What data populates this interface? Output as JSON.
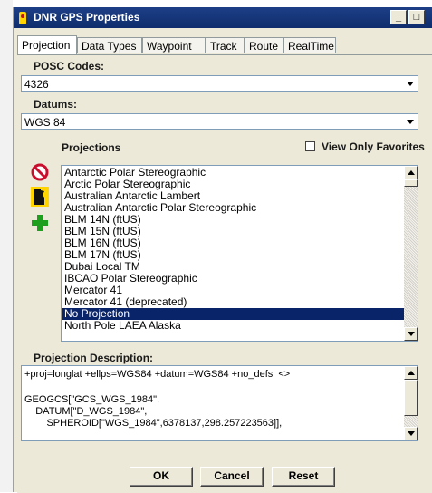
{
  "window": {
    "title": "DNR GPS Properties",
    "min_glyph": "_",
    "max_glyph": "□"
  },
  "tabs": [
    {
      "label": "Projection"
    },
    {
      "label": "Data Types"
    },
    {
      "label": "Waypoint"
    },
    {
      "label": "Track"
    },
    {
      "label": "Route"
    },
    {
      "label": "RealTime"
    }
  ],
  "posc": {
    "label": "POSC Codes:",
    "value": "4326"
  },
  "datums": {
    "label": "Datums:",
    "value": "WGS 84"
  },
  "projections": {
    "label": "Projections",
    "favorites_label": "View Only Favorites",
    "favorites_checked": false,
    "items": [
      "Antarctic Polar Stereographic",
      "Arctic Polar Stereographic",
      "Australian Antarctic Lambert",
      "Australian Antarctic Polar Stereographic",
      "BLM 14N (ftUS)",
      "BLM 15N (ftUS)",
      "BLM 16N (ftUS)",
      "BLM 17N (ftUS)",
      "Dubai Local TM",
      "IBCAO Polar Stereographic",
      "Mercator 41",
      "Mercator 41 (deprecated)",
      "No Projection",
      "North Pole LAEA Alaska"
    ],
    "selected": "No Projection"
  },
  "side_icons": [
    "no-entry-icon",
    "minnesota-state-icon",
    "add-icon"
  ],
  "description": {
    "label": "Projection Description:",
    "lines": [
      "+proj=longlat +ellps=WGS84 +datum=WGS84 +no_defs  <>",
      "",
      "GEOGCS[\"GCS_WGS_1984\",",
      "    DATUM[\"D_WGS_1984\",",
      "        SPHEROID[\"WGS_1984\",6378137,298.257223563]],"
    ]
  },
  "buttons": {
    "ok": "OK",
    "cancel": "Cancel",
    "reset": "Reset"
  },
  "colors": {
    "titlebar": "#0f2d6d",
    "selection": "#0a246a",
    "dialog_bg": "#ece9d8"
  }
}
